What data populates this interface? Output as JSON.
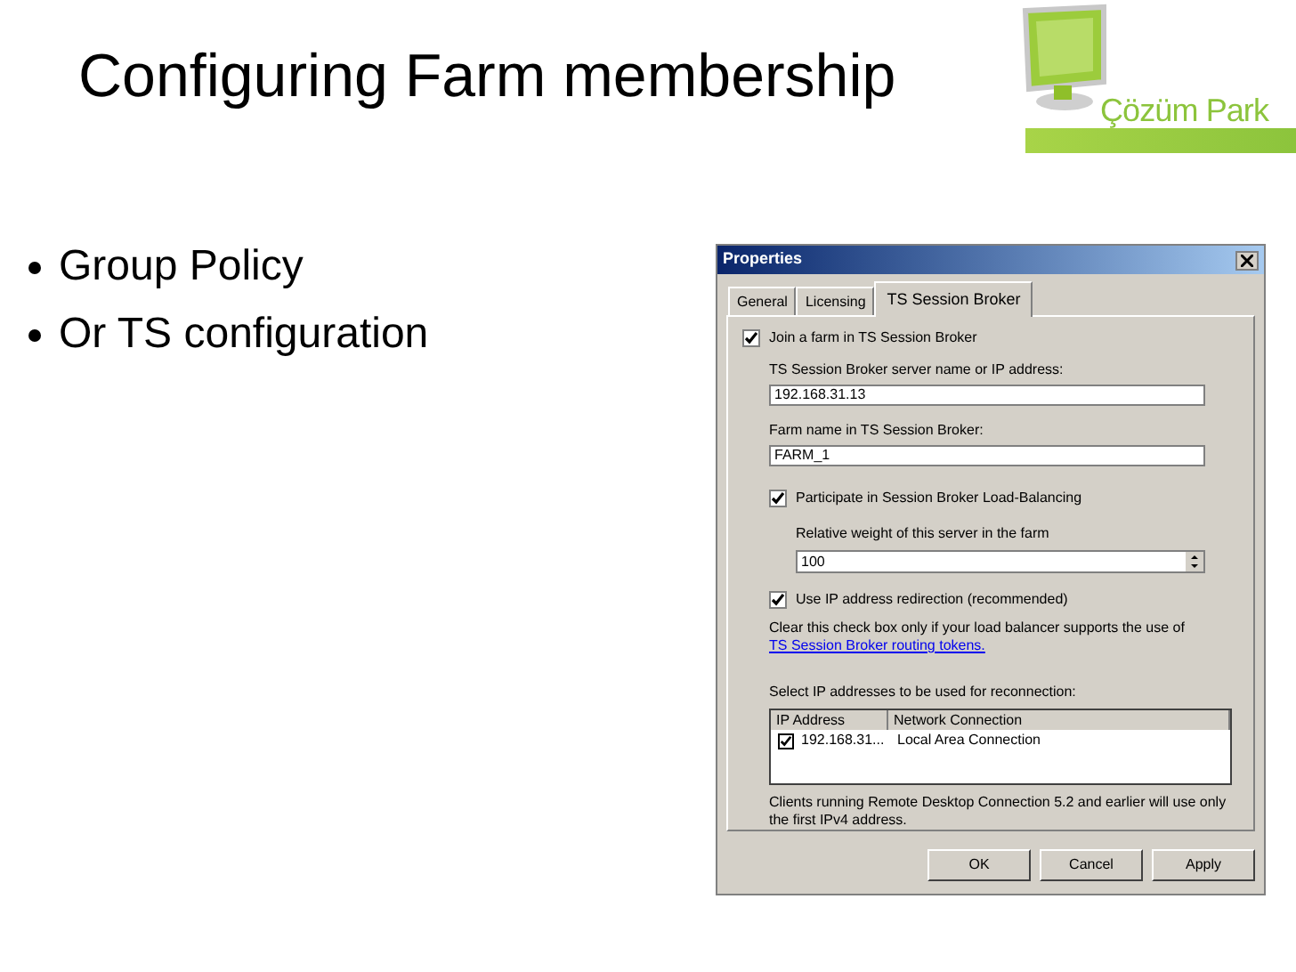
{
  "slide": {
    "title": "Configuring Farm membership",
    "bullets": [
      "Group Policy",
      "Or TS configuration"
    ],
    "logo_text": "Çözüm Park"
  },
  "dialog": {
    "title": "Properties",
    "tabs": [
      {
        "label": "General",
        "selected": false
      },
      {
        "label": "Licensing",
        "selected": false
      },
      {
        "label": "TS Session Broker",
        "selected": true
      }
    ],
    "join": {
      "label": "Join a farm in TS Session Broker",
      "checked": true
    },
    "server_label": "TS Session Broker server name or IP address:",
    "server_value": "192.168.31.13",
    "farm_label": "Farm name in TS Session Broker:",
    "farm_value": "FARM_1",
    "balancing": {
      "label": "Participate in Session Broker Load-Balancing",
      "checked": true
    },
    "weight_label": "Relative weight of this server in the farm",
    "weight_value": "100",
    "redirect": {
      "label": "Use IP address redirection (recommended)",
      "checked": true
    },
    "note": "Clear this check box only if your load balancer supports the use of",
    "link": "TS Session Broker routing tokens.",
    "select_label": "Select IP addresses to be used for reconnection:",
    "columns": [
      "IP Address",
      "Network Connection"
    ],
    "rows": [
      {
        "checked": true,
        "ip": "192.168.31...",
        "connection": "Local Area Connection"
      }
    ],
    "footnote": "Clients running Remote Desktop Connection 5.2 and earlier will use only the first IPv4 address.",
    "buttons": [
      "OK",
      "Cancel",
      "Apply"
    ]
  }
}
